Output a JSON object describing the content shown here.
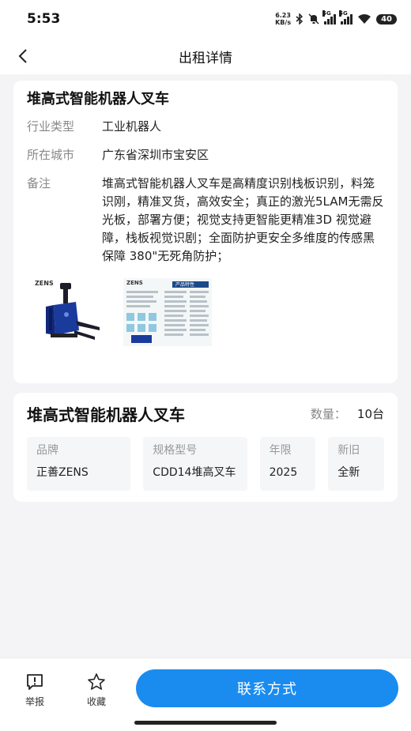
{
  "status": {
    "time": "5:53",
    "netspeed_value": "6.23",
    "netspeed_unit": "KB/s",
    "sig1": "5G",
    "sig2": "5G",
    "battery": "40"
  },
  "header": {
    "title": "出租详情",
    "back_icon": "chevron-left-icon"
  },
  "detail": {
    "title": "堆高式智能机器人叉车",
    "fields": [
      {
        "label": "行业类型",
        "value": "工业机器人"
      },
      {
        "label": "所在城市",
        "value": "广东省深圳市宝安区"
      },
      {
        "label": "备注",
        "value": "堆高式智能机器人叉车是高精度识别栈板识别，料笼识刚，精准叉货，高效安全；真正的激光5LAM无需反光板，部署方便；视觉支持更智能更精准3D 视觉避障，栈板视觉识剧；全面防护更安全多维度的传感黑保障 380\"无死角防护；"
      }
    ],
    "image1_logo": "ZENS",
    "image2_logo": "ZENS",
    "image2_tag": "产品特性"
  },
  "product": {
    "title": "堆高式智能机器人叉车",
    "qty_label": "数量：",
    "qty_value": "10台",
    "specs": [
      {
        "label": "品牌",
        "value": "正善ZENS"
      },
      {
        "label": "规格型号",
        "value": "CDD14堆高叉车"
      },
      {
        "label": "年限",
        "value": "2025"
      },
      {
        "label": "新旧",
        "value": "全新"
      }
    ]
  },
  "bottom": {
    "report_label": "举报",
    "favorite_label": "收藏",
    "contact_label": "联系方式"
  },
  "colors": {
    "accent": "#1a8cf0",
    "background": "#f4f4f6"
  }
}
